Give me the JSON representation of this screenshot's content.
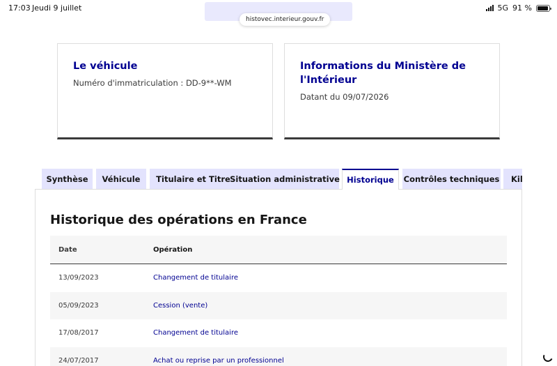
{
  "status_bar": {
    "time": "17:03",
    "date": "Jeudi 9 juillet",
    "network": "5G",
    "battery": "91 %",
    "battery_level": 0.91
  },
  "browser": {
    "url": "histovec.interieur.gouv.fr"
  },
  "cards": {
    "vehicle": {
      "title": "Le véhicule",
      "subtitle": "Numéro d'immatriculation : DD-9**-WM"
    },
    "ministry": {
      "title": "Informations du Ministère de l'Intérieur",
      "subtitle": "Datant du 09/07/2026"
    }
  },
  "tabs": [
    {
      "label": "Synthèse"
    },
    {
      "label": "Véhicule"
    },
    {
      "label": "Titulaire et Titre"
    },
    {
      "label": "Situation administrative"
    },
    {
      "label": "Historique"
    },
    {
      "label": "Contrôles techniques"
    },
    {
      "label": "Kilométrage"
    }
  ],
  "active_tab": "Historique",
  "history": {
    "title": "Historique des opérations en France",
    "columns": {
      "date": "Date",
      "operation": "Opération"
    },
    "rows": [
      {
        "date": "13/09/2023",
        "operation": "Changement de titulaire"
      },
      {
        "date": "05/09/2023",
        "operation": "Cession (vente)"
      },
      {
        "date": "17/08/2017",
        "operation": "Changement de titulaire"
      },
      {
        "date": "24/07/2017",
        "operation": "Achat ou reprise par un professionnel"
      }
    ]
  },
  "colors": {
    "accent": "#000091",
    "tab_bg": "#e3e3fd",
    "row_alt": "#f6f6f6"
  }
}
